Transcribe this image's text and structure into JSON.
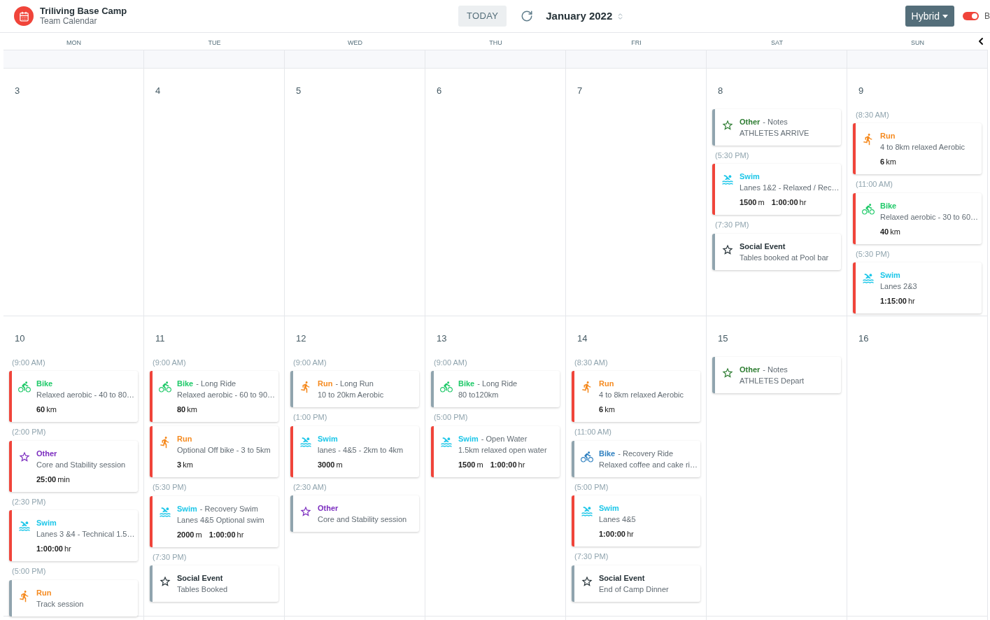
{
  "header": {
    "title": "Triliving Base Camp",
    "subtitle": "Team Calendar",
    "today_button": "TODAY",
    "month": "January 2022",
    "view_button": "Hybrid",
    "toggle": {
      "on": true
    },
    "toggle_label": "B"
  },
  "weekdays": [
    "MON",
    "TUE",
    "WED",
    "THU",
    "FRI",
    "SAT",
    "SUN"
  ],
  "weeks": [
    {
      "days": [
        {
          "date": "3"
        },
        {
          "date": "4"
        },
        {
          "date": "5"
        },
        {
          "date": "6"
        },
        {
          "date": "7"
        },
        {
          "date": "8",
          "events": [
            {
              "kind": "star",
              "type": "Other",
              "subtitle": "- Notes",
              "color": "#2e7d32",
              "flagged": false,
              "desc": "ATHLETES ARRIVE"
            },
            {
              "time": "(5:30 PM)",
              "kind": "swim",
              "type": "Swim",
              "color": "#1cc6e8",
              "flagged": true,
              "desc": "Lanes 1&2 - Relaxed / Rec…",
              "stats": [
                {
                  "value": "1500",
                  "unit": "m"
                },
                {
                  "value": "1:00:00",
                  "unit": "hr"
                }
              ]
            },
            {
              "time": "(7:30 PM)",
              "kind": "star",
              "type": "Social Event",
              "color": "#263238",
              "flagged": false,
              "desc": "Tables booked at Pool bar"
            }
          ]
        },
        {
          "date": "9",
          "events": [
            {
              "time": "(8:30 AM)",
              "kind": "run",
              "type": "Run",
              "color": "#f58a1f",
              "flagged": true,
              "desc": "4 to 8km relaxed Aerobic",
              "stats": [
                {
                  "value": "6",
                  "unit": "km"
                }
              ]
            },
            {
              "time": "(11:00 AM)",
              "kind": "bike",
              "type": "Bike",
              "color": "#1ec968",
              "flagged": true,
              "desc": "Relaxed aerobic - 30 to 60…",
              "stats": [
                {
                  "value": "40",
                  "unit": "km"
                }
              ]
            },
            {
              "time": "(5:30 PM)",
              "kind": "swim",
              "type": "Swim",
              "color": "#1cc6e8",
              "flagged": true,
              "desc": "Lanes 2&3",
              "stats": [
                {
                  "value": "1:15:00",
                  "unit": "hr"
                }
              ]
            }
          ]
        }
      ]
    },
    {
      "days": [
        {
          "date": "10",
          "events": [
            {
              "time": "(9:00 AM)",
              "kind": "bike",
              "type": "Bike",
              "color": "#1ec968",
              "flagged": true,
              "desc": "Relaxed aerobic - 40 to 80…",
              "stats": [
                {
                  "value": "60",
                  "unit": "km"
                }
              ]
            },
            {
              "time": "(2:00 PM)",
              "kind": "star",
              "type": "Other",
              "color": "#7b2cbf",
              "flagged": true,
              "desc": "Core and Stability session",
              "stats": [
                {
                  "value": "25:00",
                  "unit": "min"
                }
              ]
            },
            {
              "time": "(2:30 PM)",
              "kind": "swim",
              "type": "Swim",
              "color": "#1cc6e8",
              "flagged": true,
              "desc": "Lanes 3 &4 - Technical 1.5…",
              "stats": [
                {
                  "value": "1:00:00",
                  "unit": "hr"
                }
              ]
            },
            {
              "time": "(5:00 PM)",
              "kind": "run",
              "type": "Run",
              "color": "#f58a1f",
              "flagged": false,
              "desc": "Track session"
            }
          ]
        },
        {
          "date": "11",
          "events": [
            {
              "time": "(9:00 AM)",
              "kind": "bike",
              "type": "Bike",
              "subtitle": "- Long Ride",
              "color": "#1ec968",
              "flagged": true,
              "desc": "Relaxed aerobic - 60 to 90…",
              "stats": [
                {
                  "value": "80",
                  "unit": "km"
                }
              ]
            },
            {
              "kind": "run",
              "type": "Run",
              "color": "#f58a1f",
              "flagged": true,
              "desc": "Optional Off bike - 3 to 5km",
              "stats": [
                {
                  "value": "3",
                  "unit": "km"
                }
              ]
            },
            {
              "time": "(5:30 PM)",
              "kind": "swim",
              "type": "Swim",
              "subtitle": "- Recovery Swim",
              "color": "#1cc6e8",
              "flagged": true,
              "desc": "Lanes 4&5 Optional swim",
              "stats": [
                {
                  "value": "2000",
                  "unit": "m"
                },
                {
                  "value": "1:00:00",
                  "unit": "hr"
                }
              ]
            },
            {
              "time": "(7:30 PM)",
              "kind": "star",
              "type": "Social Event",
              "color": "#263238",
              "flagged": false,
              "desc": "Tables Booked"
            }
          ]
        },
        {
          "date": "12",
          "events": [
            {
              "time": "(9:00 AM)",
              "kind": "run",
              "type": "Run",
              "subtitle": "- Long Run",
              "color": "#f58a1f",
              "flagged": false,
              "desc": "10 to 20km Aerobic"
            },
            {
              "time": "(1:00 PM)",
              "kind": "swim",
              "type": "Swim",
              "color": "#1cc6e8",
              "flagged": true,
              "desc": "lanes - 4&5 - 2km to 4km",
              "stats": [
                {
                  "value": "3000",
                  "unit": "m"
                }
              ]
            },
            {
              "time": "(2:30 AM)",
              "kind": "star",
              "type": "Other",
              "color": "#7b2cbf",
              "flagged": false,
              "desc": "Core and Stability session"
            }
          ]
        },
        {
          "date": "13",
          "events": [
            {
              "time": "(9:00 AM)",
              "kind": "bike",
              "type": "Bike",
              "subtitle": "- Long Ride",
              "color": "#1ec968",
              "flagged": false,
              "desc": "80 to120km"
            },
            {
              "time": "(5:00 PM)",
              "kind": "swim",
              "type": "Swim",
              "subtitle": "- Open Water",
              "color": "#1cc6e8",
              "flagged": true,
              "desc": "1.5km relaxed open water",
              "stats": [
                {
                  "value": "1500",
                  "unit": "m"
                },
                {
                  "value": "1:00:00",
                  "unit": "hr"
                }
              ]
            }
          ]
        },
        {
          "date": "14",
          "events": [
            {
              "time": "(8:30 AM)",
              "kind": "run",
              "type": "Run",
              "color": "#f58a1f",
              "flagged": true,
              "desc": "4 to 8km relaxed Aerobic",
              "stats": [
                {
                  "value": "6",
                  "unit": "km"
                }
              ]
            },
            {
              "time": "(11:00 AM)",
              "kind": "bike",
              "type": "Bike",
              "subtitle": "- Recovery Ride",
              "color": "#2f80c0",
              "flagged": false,
              "desc": "Relaxed coffee and cake ri…"
            },
            {
              "time": "(5:00 PM)",
              "kind": "swim",
              "type": "Swim",
              "color": "#1cc6e8",
              "flagged": true,
              "desc": "Lanes 4&5",
              "stats": [
                {
                  "value": "1:00:00",
                  "unit": "hr"
                }
              ]
            },
            {
              "time": "(7:30 PM)",
              "kind": "star",
              "type": "Social Event",
              "color": "#263238",
              "flagged": false,
              "desc": "End of Camp Dinner"
            }
          ]
        },
        {
          "date": "15",
          "events": [
            {
              "kind": "star",
              "type": "Other",
              "subtitle": "- Notes",
              "color": "#2e7d32",
              "flagged": false,
              "desc": "ATHLETES Depart"
            }
          ]
        },
        {
          "date": "16"
        }
      ]
    }
  ]
}
